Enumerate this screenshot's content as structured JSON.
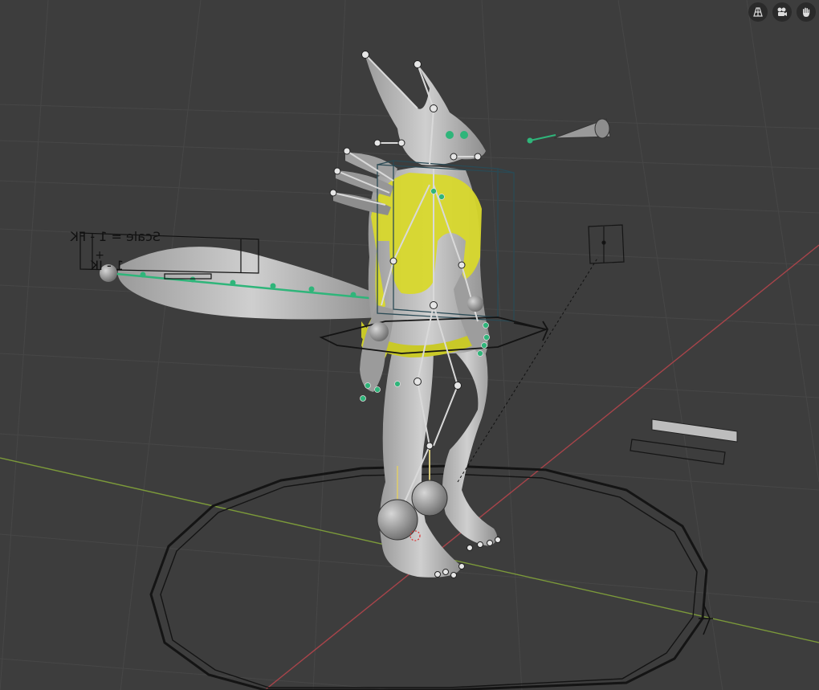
{
  "viewport": {
    "background": "#3d3d3d",
    "grid_color": "#4a4a4a",
    "axis_x_color": "#b0474b",
    "axis_y_color": "#7f9a3c"
  },
  "nav_icons": [
    {
      "name": "toggle-orthographic-perspective",
      "icon": "grid-perspective-icon"
    },
    {
      "name": "toggle-camera-view",
      "icon": "camera-icon"
    },
    {
      "name": "pan-view",
      "icon": "hand-icon"
    }
  ],
  "annotations": {
    "scale_line": "Scale = 1 - FK",
    "plus_line": "+",
    "ik_line": "1 - IK"
  },
  "colors": {
    "mesh": "#a9a9a9",
    "mesh_light": "#c9c9c9",
    "vest": "#d8d82c",
    "bone_active": "#2fb57a",
    "bone": "#b8b8b8",
    "wire": "#111111"
  }
}
